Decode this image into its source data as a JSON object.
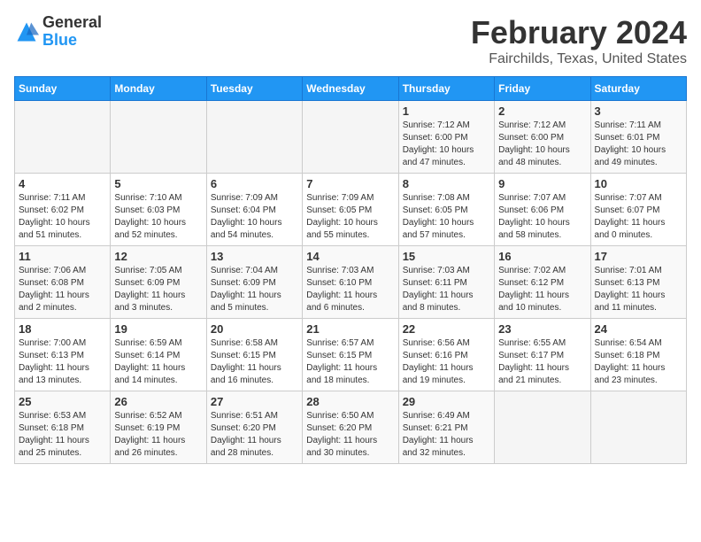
{
  "header": {
    "logo_general": "General",
    "logo_blue": "Blue",
    "title": "February 2024",
    "subtitle": "Fairchilds, Texas, United States"
  },
  "days_of_week": [
    "Sunday",
    "Monday",
    "Tuesday",
    "Wednesday",
    "Thursday",
    "Friday",
    "Saturday"
  ],
  "weeks": [
    [
      {
        "date": "",
        "info": ""
      },
      {
        "date": "",
        "info": ""
      },
      {
        "date": "",
        "info": ""
      },
      {
        "date": "",
        "info": ""
      },
      {
        "date": "1",
        "info": "Sunrise: 7:12 AM\nSunset: 6:00 PM\nDaylight: 10 hours\nand 47 minutes."
      },
      {
        "date": "2",
        "info": "Sunrise: 7:12 AM\nSunset: 6:00 PM\nDaylight: 10 hours\nand 48 minutes."
      },
      {
        "date": "3",
        "info": "Sunrise: 7:11 AM\nSunset: 6:01 PM\nDaylight: 10 hours\nand 49 minutes."
      }
    ],
    [
      {
        "date": "4",
        "info": "Sunrise: 7:11 AM\nSunset: 6:02 PM\nDaylight: 10 hours\nand 51 minutes."
      },
      {
        "date": "5",
        "info": "Sunrise: 7:10 AM\nSunset: 6:03 PM\nDaylight: 10 hours\nand 52 minutes."
      },
      {
        "date": "6",
        "info": "Sunrise: 7:09 AM\nSunset: 6:04 PM\nDaylight: 10 hours\nand 54 minutes."
      },
      {
        "date": "7",
        "info": "Sunrise: 7:09 AM\nSunset: 6:05 PM\nDaylight: 10 hours\nand 55 minutes."
      },
      {
        "date": "8",
        "info": "Sunrise: 7:08 AM\nSunset: 6:05 PM\nDaylight: 10 hours\nand 57 minutes."
      },
      {
        "date": "9",
        "info": "Sunrise: 7:07 AM\nSunset: 6:06 PM\nDaylight: 10 hours\nand 58 minutes."
      },
      {
        "date": "10",
        "info": "Sunrise: 7:07 AM\nSunset: 6:07 PM\nDaylight: 11 hours\nand 0 minutes."
      }
    ],
    [
      {
        "date": "11",
        "info": "Sunrise: 7:06 AM\nSunset: 6:08 PM\nDaylight: 11 hours\nand 2 minutes."
      },
      {
        "date": "12",
        "info": "Sunrise: 7:05 AM\nSunset: 6:09 PM\nDaylight: 11 hours\nand 3 minutes."
      },
      {
        "date": "13",
        "info": "Sunrise: 7:04 AM\nSunset: 6:09 PM\nDaylight: 11 hours\nand 5 minutes."
      },
      {
        "date": "14",
        "info": "Sunrise: 7:03 AM\nSunset: 6:10 PM\nDaylight: 11 hours\nand 6 minutes."
      },
      {
        "date": "15",
        "info": "Sunrise: 7:03 AM\nSunset: 6:11 PM\nDaylight: 11 hours\nand 8 minutes."
      },
      {
        "date": "16",
        "info": "Sunrise: 7:02 AM\nSunset: 6:12 PM\nDaylight: 11 hours\nand 10 minutes."
      },
      {
        "date": "17",
        "info": "Sunrise: 7:01 AM\nSunset: 6:13 PM\nDaylight: 11 hours\nand 11 minutes."
      }
    ],
    [
      {
        "date": "18",
        "info": "Sunrise: 7:00 AM\nSunset: 6:13 PM\nDaylight: 11 hours\nand 13 minutes."
      },
      {
        "date": "19",
        "info": "Sunrise: 6:59 AM\nSunset: 6:14 PM\nDaylight: 11 hours\nand 14 minutes."
      },
      {
        "date": "20",
        "info": "Sunrise: 6:58 AM\nSunset: 6:15 PM\nDaylight: 11 hours\nand 16 minutes."
      },
      {
        "date": "21",
        "info": "Sunrise: 6:57 AM\nSunset: 6:15 PM\nDaylight: 11 hours\nand 18 minutes."
      },
      {
        "date": "22",
        "info": "Sunrise: 6:56 AM\nSunset: 6:16 PM\nDaylight: 11 hours\nand 19 minutes."
      },
      {
        "date": "23",
        "info": "Sunrise: 6:55 AM\nSunset: 6:17 PM\nDaylight: 11 hours\nand 21 minutes."
      },
      {
        "date": "24",
        "info": "Sunrise: 6:54 AM\nSunset: 6:18 PM\nDaylight: 11 hours\nand 23 minutes."
      }
    ],
    [
      {
        "date": "25",
        "info": "Sunrise: 6:53 AM\nSunset: 6:18 PM\nDaylight: 11 hours\nand 25 minutes."
      },
      {
        "date": "26",
        "info": "Sunrise: 6:52 AM\nSunset: 6:19 PM\nDaylight: 11 hours\nand 26 minutes."
      },
      {
        "date": "27",
        "info": "Sunrise: 6:51 AM\nSunset: 6:20 PM\nDaylight: 11 hours\nand 28 minutes."
      },
      {
        "date": "28",
        "info": "Sunrise: 6:50 AM\nSunset: 6:20 PM\nDaylight: 11 hours\nand 30 minutes."
      },
      {
        "date": "29",
        "info": "Sunrise: 6:49 AM\nSunset: 6:21 PM\nDaylight: 11 hours\nand 32 minutes."
      },
      {
        "date": "",
        "info": ""
      },
      {
        "date": "",
        "info": ""
      }
    ]
  ]
}
